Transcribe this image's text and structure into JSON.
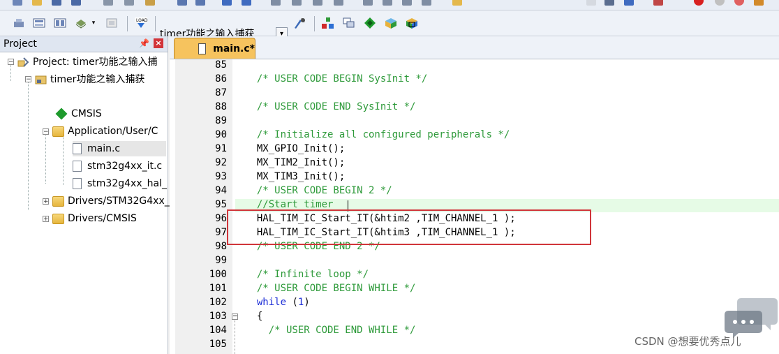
{
  "toolbar": {
    "target_name": "timer功能之输入捕获"
  },
  "project_panel": {
    "title": "Project",
    "tree": [
      {
        "label": "Project: timer功能之输入捕",
        "level": 0,
        "kind": "project"
      },
      {
        "label": "timer功能之输入捕获",
        "level": 1,
        "kind": "target"
      },
      {
        "label": "CMSIS",
        "level": 2,
        "kind": "component"
      },
      {
        "label": "Application/User/C",
        "level": 2,
        "kind": "folder"
      },
      {
        "label": "main.c",
        "level": 3,
        "kind": "file",
        "selected": true
      },
      {
        "label": "stm32g4xx_it.c",
        "level": 3,
        "kind": "file"
      },
      {
        "label": "stm32g4xx_hal_",
        "level": 3,
        "kind": "file"
      },
      {
        "label": "Drivers/STM32G4xx_",
        "level": 2,
        "kind": "folder"
      },
      {
        "label": "Drivers/CMSIS",
        "level": 2,
        "kind": "folder"
      }
    ]
  },
  "editor": {
    "active_tab": "main.c*",
    "lines": [
      {
        "n": "85",
        "text": "",
        "cls": ""
      },
      {
        "n": "86",
        "text": "  /* USER CODE BEGIN SysInit */",
        "cls": "cm"
      },
      {
        "n": "87",
        "text": "",
        "cls": ""
      },
      {
        "n": "88",
        "text": "  /* USER CODE END SysInit */",
        "cls": "cm"
      },
      {
        "n": "89",
        "text": "",
        "cls": ""
      },
      {
        "n": "90",
        "text": "  /* Initialize all configured peripherals */",
        "cls": "cm"
      },
      {
        "n": "91",
        "text": "  MX_GPIO_Init();",
        "cls": ""
      },
      {
        "n": "92",
        "text": "  MX_TIM2_Init();",
        "cls": ""
      },
      {
        "n": "93",
        "text": "  MX_TIM3_Init();",
        "cls": ""
      },
      {
        "n": "94",
        "text": "  /* USER CODE BEGIN 2 */",
        "cls": "cm"
      },
      {
        "n": "95",
        "text": "  //Start timer",
        "cls": "cm"
      },
      {
        "n": "96",
        "text": "  HAL_TIM_IC_Start_IT(&htim2 ,TIM_CHANNEL_1 );",
        "cls": ""
      },
      {
        "n": "97",
        "text": "  HAL_TIM_IC_Start_IT(&htim3 ,TIM_CHANNEL_1 );",
        "cls": ""
      },
      {
        "n": "98",
        "text": "  /* USER CODE END 2 */",
        "cls": "cm"
      },
      {
        "n": "99",
        "text": "",
        "cls": ""
      },
      {
        "n": "100",
        "text": "  /* Infinite loop */",
        "cls": "cm"
      },
      {
        "n": "101",
        "text": "  /* USER CODE BEGIN WHILE */",
        "cls": "cm"
      },
      {
        "n": "102",
        "text": "  while (1)",
        "cls": "kw"
      },
      {
        "n": "103",
        "text": "  {",
        "cls": ""
      },
      {
        "n": "104",
        "text": "    /* USER CODE END WHILE */",
        "cls": "cm"
      },
      {
        "n": "105",
        "text": "",
        "cls": ""
      }
    ]
  },
  "watermark": "CSDN @想要优秀点儿",
  "colors": {
    "comment": "#2e9a3a",
    "keyword": "#1a2bd6",
    "tab_active": "#f6c35e",
    "highlight_box": "#d0353a",
    "current_line": "#e6fbe6"
  }
}
